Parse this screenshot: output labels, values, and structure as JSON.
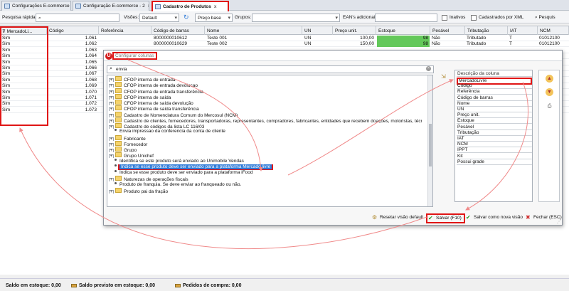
{
  "tabs": [
    {
      "label": "Configurações E-commerce",
      "close": "x"
    },
    {
      "label": "Configuração E-commerce - 2",
      "close": "x"
    },
    {
      "label": "Cadastro de Produtos",
      "close": "x"
    }
  ],
  "filters": {
    "quick_search_label": "Pesquisa rápida:",
    "views_label": "Visões:",
    "views_value": "Default",
    "price_value": "Preço base",
    "groups_label": "Grupos:",
    "eans_label": "EAN's adicionais:",
    "inactive_label": "Inativos",
    "xml_label": "Cadastrados por XML",
    "search_button": "Pesquis"
  },
  "grid": {
    "headers": [
      "MercadoLi...",
      "Código",
      "Referência",
      "Código de barras",
      "Nome",
      "UN",
      "Preço unit.",
      "Estoque",
      "Pesável",
      "Tributação",
      "IAT",
      "NCM"
    ],
    "rows": [
      {
        "ml": "Sim",
        "code": "1.061",
        "barcode": "8000000010612",
        "name": "Teste 001",
        "un": "UN",
        "price": "100,00",
        "stock": "98",
        "pes": "Não",
        "trib": "Tributado",
        "iat": "T",
        "ncm": "01012100"
      },
      {
        "ml": "Sim",
        "code": "1.062",
        "barcode": "8000000010629",
        "name": "Teste 002",
        "un": "UN",
        "price": "150,00",
        "stock": "98",
        "pes": "Não",
        "trib": "Tributado",
        "iat": "T",
        "ncm": "01012100"
      },
      {
        "ml": "Sim",
        "code": "1.063",
        "barcode": "",
        "name": "",
        "un": "",
        "price": "",
        "stock": "",
        "pes": "",
        "trib": "",
        "iat": "",
        "ncm": ""
      },
      {
        "ml": "Sim",
        "code": "1.064"
      },
      {
        "ml": "Sim",
        "code": "1.065"
      },
      {
        "ml": "Sim",
        "code": "1.066"
      },
      {
        "ml": "Sim",
        "code": "1.067"
      },
      {
        "ml": "Sim",
        "code": "1.068"
      },
      {
        "ml": "Sim",
        "code": "1.069"
      },
      {
        "ml": "Sim",
        "code": "1.070"
      },
      {
        "ml": "Sim",
        "code": "1.071"
      },
      {
        "ml": "Sim",
        "code": "1.072"
      },
      {
        "ml": "Sim",
        "code": "1.073"
      }
    ]
  },
  "status": {
    "stock": "Saldo em estoque: 0,00",
    "forecast": "Saldo previsto em estoque: 0,00",
    "orders": "Pedidos de compra: 0,00"
  },
  "modal": {
    "title": "Configurar colunas",
    "search_value": "envia",
    "tree": [
      {
        "type": "folder",
        "label": "CFOP interna de entrada"
      },
      {
        "type": "folder",
        "label": "CFOP interna de entrada devolucao"
      },
      {
        "type": "folder",
        "label": "CFOP interna de entrada transferência"
      },
      {
        "type": "folder",
        "label": "CFOP interna de saída"
      },
      {
        "type": "folder",
        "label": "CFOP interna de saída devolução"
      },
      {
        "type": "folder",
        "label": "CFOP interna de saída transferência"
      },
      {
        "type": "folder",
        "label": "Cadastro de Nomenclatura Comum do Mercosul (NCM)"
      },
      {
        "type": "folder",
        "label": "Cadastro de clientes, fornecedores, transportadoras, representantes, compradores, fabricantes, entidades que recebem doações, motoristas, técnicos"
      },
      {
        "type": "folder",
        "label": "Cadastro de códigos da lista LC 116/03"
      },
      {
        "type": "leaf",
        "label": "Envia impressao da conferencia da conta de cliente"
      },
      {
        "type": "folder",
        "label": "Fabricante"
      },
      {
        "type": "folder",
        "label": "Fornecedor"
      },
      {
        "type": "folder",
        "label": "Grupo"
      },
      {
        "type": "folder",
        "label": "Grupo Unichef"
      },
      {
        "type": "leaf",
        "label": "Identifica se este produto será enviado ao Unimobile Vendas"
      },
      {
        "type": "leaf",
        "label": "Indica se esse produto deve ser enviado para a plataforma Mercado livre",
        "selected": true
      },
      {
        "type": "leaf",
        "label": "Indica se esse produto deve ser enviado para a plataforma iFood"
      },
      {
        "type": "folder",
        "label": "Naturezas de operações fiscais"
      },
      {
        "type": "leaf",
        "label": "Produto de franquia. Se deve enviar ao franqueado ou não."
      },
      {
        "type": "folder",
        "label": "Produto pai da fração"
      }
    ],
    "columns_header": "Descrição da coluna",
    "columns": [
      "MercadoLivre",
      "Código",
      "Referência",
      "Código de barras",
      "Nome",
      "UN",
      "Preço unit.",
      "Estoque",
      "Pesável",
      "Tributação",
      "IAT",
      "NCM",
      "IPPT",
      "Kit",
      "Possui grade"
    ],
    "buttons": {
      "reset": "Resetar visão default",
      "save": "Salvar (F10)",
      "save_new": "Salvar como nova visão",
      "close": "Fechar (ESC)"
    }
  },
  "colors": {
    "accent_red": "#e01515",
    "stock_green": "#63c85a",
    "selection_blue": "#2f7bd8"
  }
}
